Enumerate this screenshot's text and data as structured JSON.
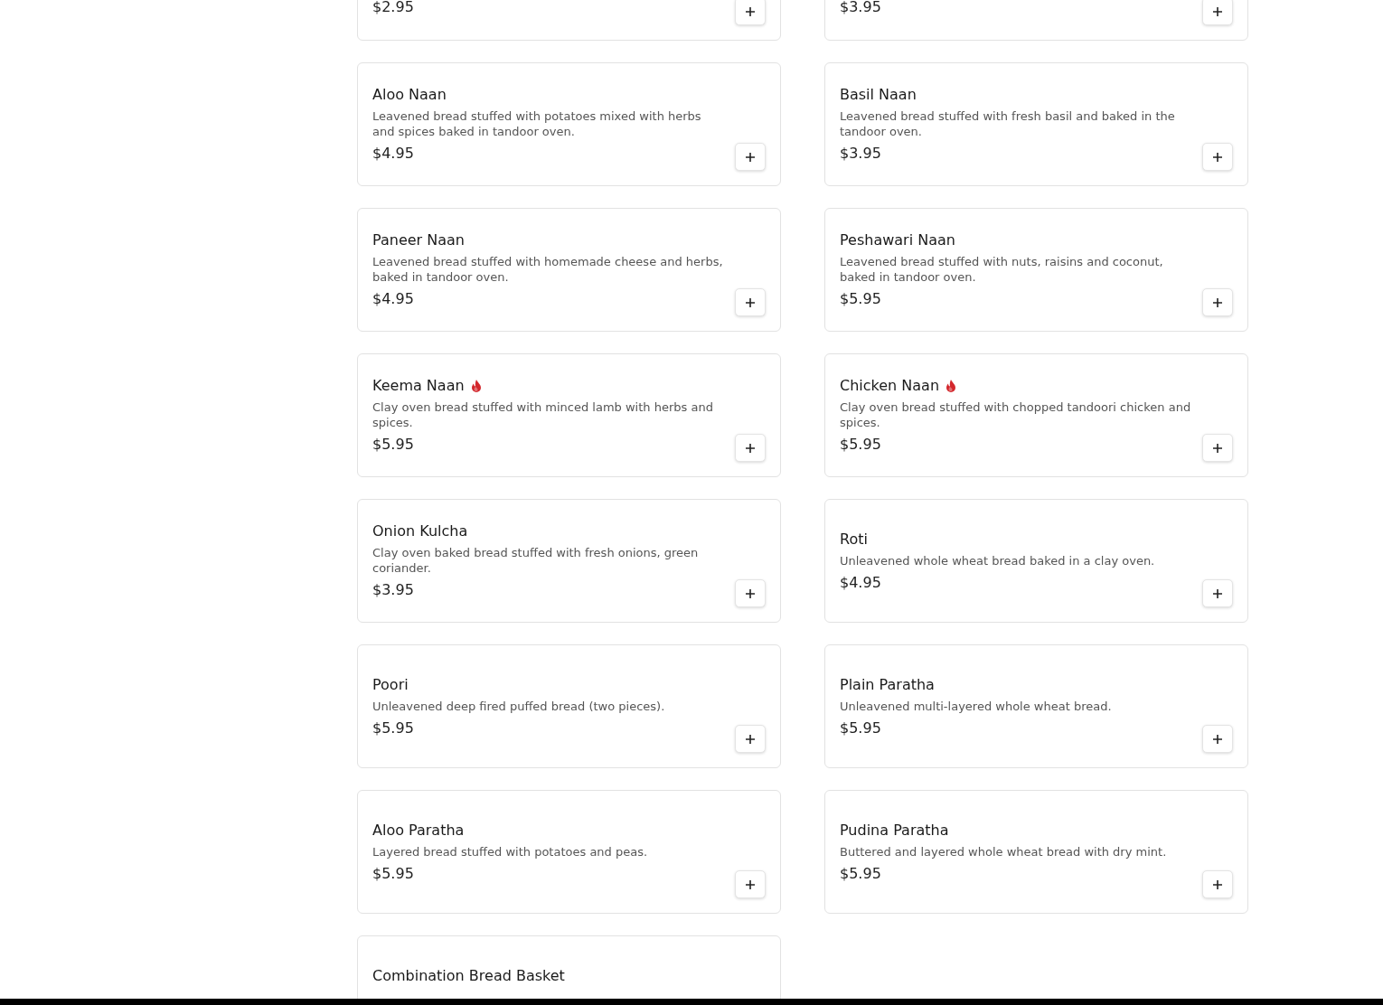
{
  "items": [
    {
      "kind": "partial",
      "price": "$2.95"
    },
    {
      "kind": "partial",
      "price": "$3.95"
    },
    {
      "kind": "full",
      "name": "Aloo Naan",
      "spicy": false,
      "description": "Leavened bread stuffed with potatoes mixed with herbs and spices baked in tandoor oven.",
      "price": "$4.95"
    },
    {
      "kind": "full",
      "name": "Basil Naan",
      "spicy": false,
      "description": "Leavened bread stuffed with fresh basil and baked in the tandoor oven.",
      "price": "$3.95"
    },
    {
      "kind": "full",
      "name": "Paneer Naan",
      "spicy": false,
      "description": "Leavened bread stuffed with homemade cheese and herbs, baked in tandoor oven.",
      "price": "$4.95"
    },
    {
      "kind": "full",
      "name": "Peshawari Naan",
      "spicy": false,
      "description": "Leavened bread stuffed with nuts, raisins and coconut, baked in tandoor oven.",
      "price": "$5.95"
    },
    {
      "kind": "full",
      "name": "Keema Naan",
      "spicy": true,
      "description": "Clay oven bread stuffed with minced lamb with herbs and spices.",
      "price": "$5.95"
    },
    {
      "kind": "full",
      "name": "Chicken Naan",
      "spicy": true,
      "description": "Clay oven bread stuffed with chopped tandoori chicken and spices.",
      "price": "$5.95"
    },
    {
      "kind": "full",
      "name": "Onion Kulcha",
      "spicy": false,
      "description": "Clay oven baked bread stuffed with fresh onions, green coriander.",
      "price": "$3.95"
    },
    {
      "kind": "full",
      "name": "Roti",
      "spicy": false,
      "description": "Unleavened whole wheat bread baked in a clay oven.",
      "price": "$4.95"
    },
    {
      "kind": "full",
      "name": "Poori",
      "spicy": false,
      "description": "Unleavened deep fired puffed bread (two pieces).",
      "price": "$5.95"
    },
    {
      "kind": "full",
      "name": "Plain Paratha",
      "spicy": false,
      "description": "Unleavened multi-layered whole wheat bread.",
      "price": "$5.95"
    },
    {
      "kind": "full",
      "name": "Aloo Paratha",
      "spicy": false,
      "description": "Layered bread stuffed with potatoes and peas.",
      "price": "$5.95"
    },
    {
      "kind": "full",
      "name": "Pudina Paratha",
      "spicy": false,
      "description": "Buttered and layered whole wheat bread with dry mint.",
      "price": "$5.95"
    },
    {
      "kind": "cut",
      "name": "Combination Bread Basket",
      "spicy": false
    }
  ]
}
